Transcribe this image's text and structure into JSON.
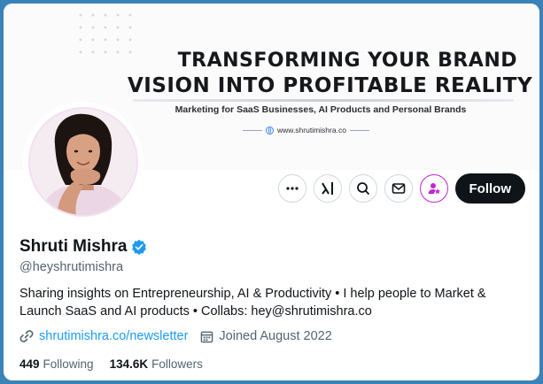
{
  "banner": {
    "headline_line1": "TRANSFORMING YOUR BRAND",
    "headline_line2": "VISION INTO PROFITABLE REALITY",
    "tagline": "Marketing for SaaS Businesses, AI Products and Personal Brands",
    "website": "www.shrutimishra.co"
  },
  "profile": {
    "name": "Shruti Mishra",
    "handle": "@heyshrutimishra",
    "bio_line1": "Sharing insights on Entrepreneurship, AI & Productivity •  I help people to Market &",
    "bio_line2": "Launch SaaS and AI products •  Collabs: hey@shrutimishra.co",
    "link": "shrutimishra.co/newsletter",
    "joined": "Joined August 2022",
    "verified_color": "#1d9bf0"
  },
  "actions": {
    "follow_label": "Follow",
    "icons": [
      "more-icon",
      "grok-icon",
      "search-icon",
      "message-icon",
      "subscribe-icon"
    ]
  },
  "stats": {
    "following_count": "449",
    "following_label": "Following",
    "followers_count": "134.6K",
    "followers_label": "Followers"
  },
  "colors": {
    "accent": "#1d9bf0",
    "subscribe": "#c026d3",
    "follow_bg": "#0f1419"
  }
}
